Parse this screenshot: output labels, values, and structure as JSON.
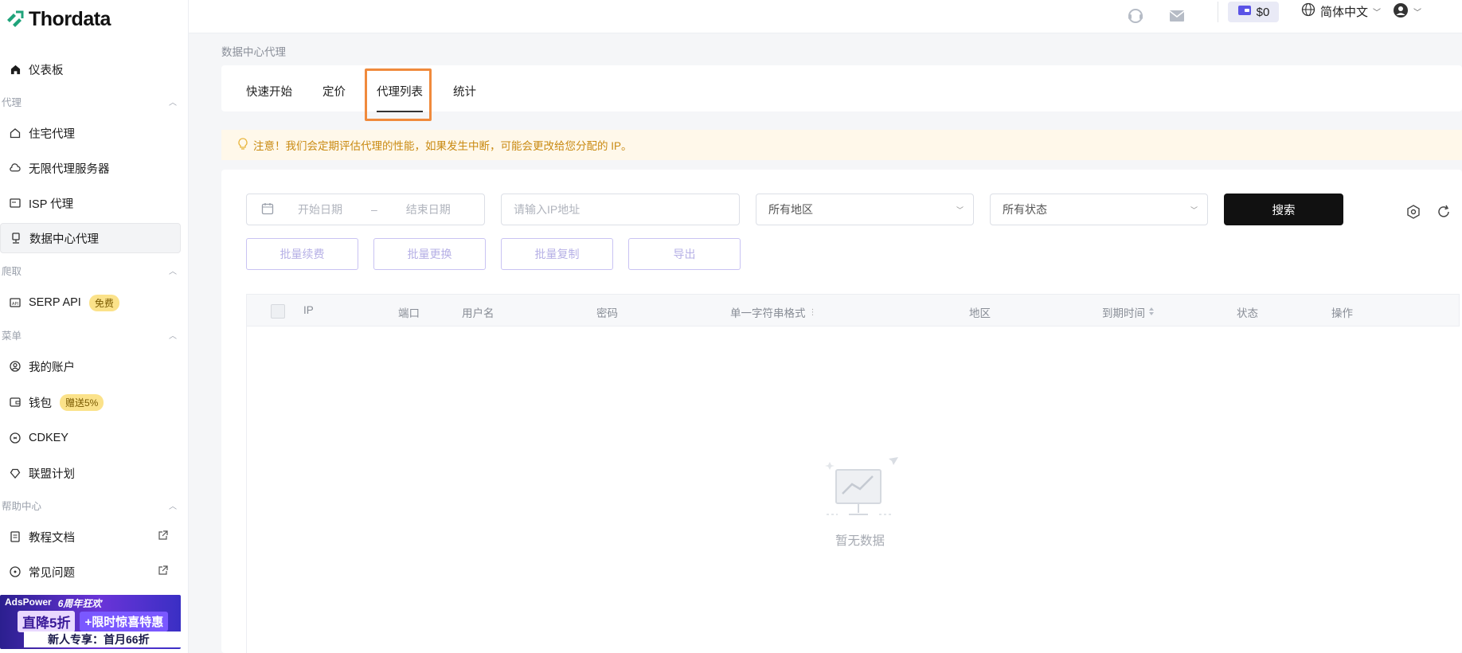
{
  "brand": {
    "name": "Thordata",
    "accent": "#1fa37a"
  },
  "sidebar": {
    "dashboard": "仪表板",
    "section_proxy": "代理",
    "proxy_items": [
      "住宅代理",
      "无限代理服务器",
      "ISP 代理",
      "数据中心代理"
    ],
    "section_scrape": "爬取",
    "serp_api": "SERP API",
    "serp_badge": "免费",
    "section_menu": "菜单",
    "my_account": "我的账户",
    "wallet": "钱包",
    "wallet_badge": "赠送5%",
    "cdkey": "CDKEY",
    "affiliate": "联盟计划",
    "section_help": "帮助中心",
    "docs": "教程文档",
    "faq": "常见问题"
  },
  "promo": {
    "brand": "AdsPower",
    "anniversary": "6周年狂欢",
    "discount_a": "直降5折",
    "discount_b": "+限时惊喜特惠",
    "newuser": "新人专享：首月66折"
  },
  "topbar": {
    "balance": "$0",
    "language": "简体中文"
  },
  "page": {
    "breadcrumb": "数据中心代理",
    "tabs": [
      "快速开始",
      "定价",
      "代理列表",
      "统计"
    ],
    "active_tab": "代理列表",
    "notice": "注意！我们会定期评估代理的性能，如果发生中断，可能会更改给您分配的 IP。"
  },
  "filters": {
    "start_date": "开始日期",
    "date_sep": "–",
    "end_date": "结束日期",
    "ip_placeholder": "请输入IP地址",
    "region": "所有地区",
    "status": "所有状态",
    "search": "搜索"
  },
  "actions": [
    "批量续费",
    "批量更换",
    "批量复制",
    "导出"
  ],
  "table": {
    "headers": [
      "IP",
      "端口",
      "用户名",
      "密码",
      "单一字符串格式",
      "地区",
      "到期时间",
      "状态",
      "操作"
    ],
    "empty": "暂无数据"
  }
}
